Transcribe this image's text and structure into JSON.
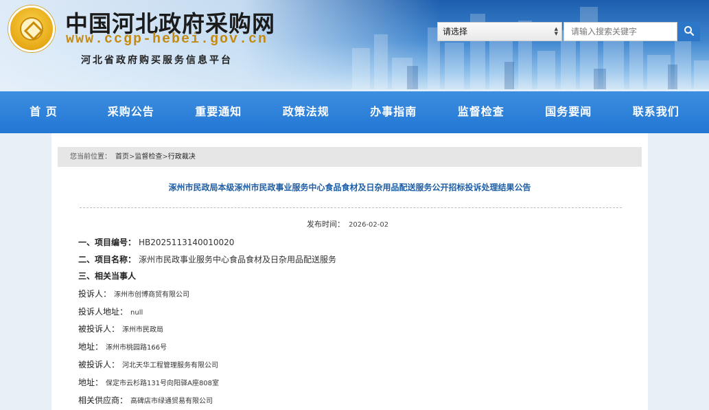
{
  "header": {
    "site_title": "中国河北政府采购网",
    "site_url": "www.ccgp-hebei.gov.cn",
    "site_subtitle": "河北省政府购买服务信息平台",
    "logo_icon": "emblem-icon"
  },
  "search": {
    "select_value": "请选择",
    "placeholder": "请输入搜索关键字",
    "button_icon": "search-icon"
  },
  "nav": {
    "items": [
      "首 页",
      "采购公告",
      "重要通知",
      "政策法规",
      "办事指南",
      "监督检查",
      "国务要闻",
      "联系我们"
    ]
  },
  "breadcrumb": {
    "label": "您当前位置：",
    "home": "首页",
    "sep1": ">",
    "section": "监督检查",
    "sep2": ">",
    "current": "行政裁决"
  },
  "article": {
    "title": "涿州市民政局本级涿州市民政事业服务中心食品食材及日杂用品配送服务公开招标投诉处理结果公告",
    "publish_label": "发布时间：",
    "publish_date": "2026-02-02",
    "rows": [
      {
        "label": "一、项目编号：",
        "value": "HB2025113140010020"
      },
      {
        "label": "二、项目名称：",
        "value": "涿州市民政事业服务中心食品食材及日杂用品配送服务"
      },
      {
        "label": "三、相关当事人",
        "value": ""
      },
      {
        "label": "投诉人：",
        "value": "涿州市创博商贸有限公司"
      },
      {
        "label": "投诉人地址：",
        "value": "null"
      },
      {
        "label": "被投诉人：",
        "value": "涿州市民政局"
      },
      {
        "label": "地址：",
        "value": "涿州市桃园路166号"
      },
      {
        "label": "被投诉人：",
        "value": "河北天华工程管理服务有限公司"
      },
      {
        "label": "地址：",
        "value": "保定市云杉路131号向阳驿A座808室"
      },
      {
        "label": "相关供应商：",
        "value": "高碑店市绿通贸易有限公司"
      }
    ]
  },
  "colors": {
    "nav_bg": "#2377d3",
    "title_blue": "#1d5ea6",
    "url_gold": "#c48a12",
    "page_bg": "#e9eff6"
  }
}
